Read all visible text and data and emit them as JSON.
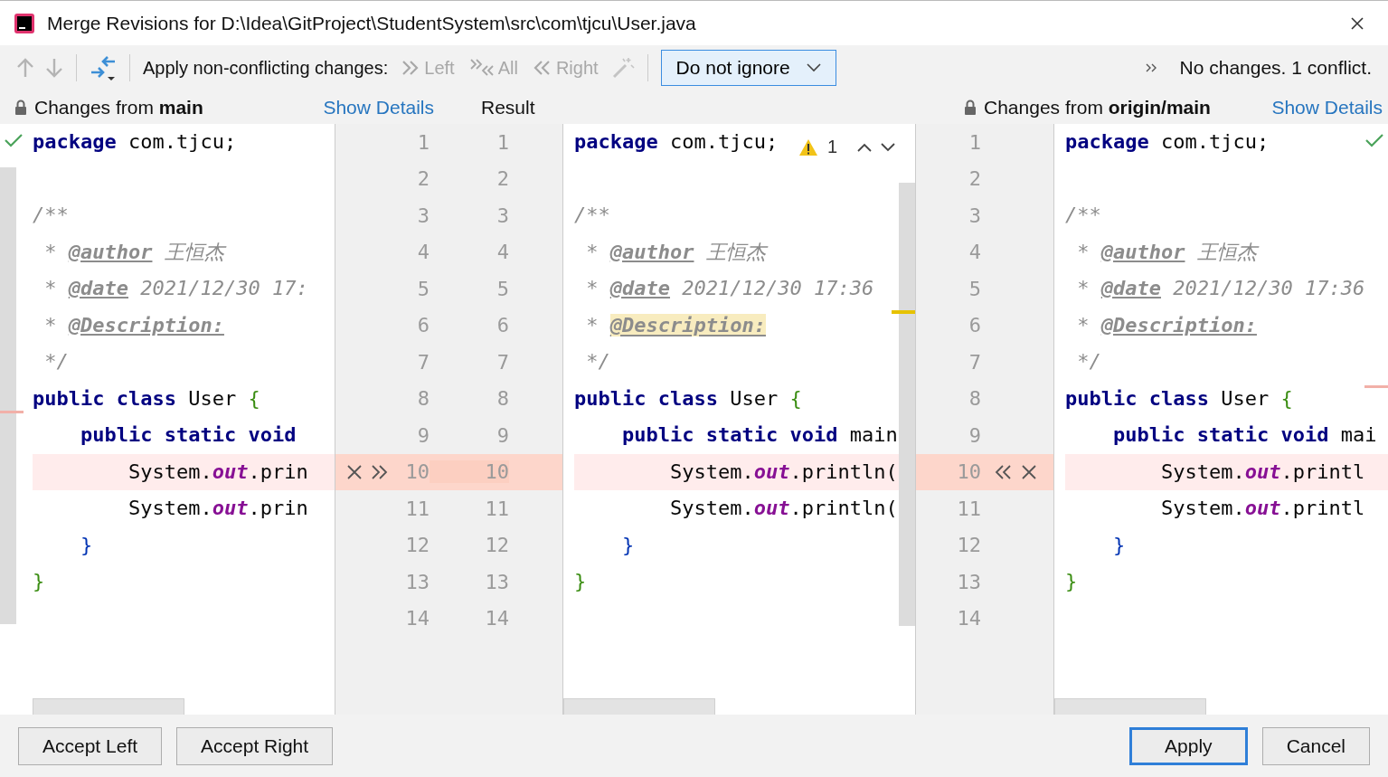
{
  "window": {
    "title": "Merge Revisions for D:\\Idea\\GitProject\\StudentSystem\\src\\com\\tjcu\\User.java"
  },
  "toolbar": {
    "apply_label": "Apply non-conflicting changes:",
    "actions": [
      {
        "kind": "left",
        "label": "Left",
        "disabled": true
      },
      {
        "kind": "all",
        "label": "All",
        "disabled": true
      },
      {
        "kind": "right",
        "label": "Right",
        "disabled": true
      }
    ],
    "ignore": {
      "value": "Do not ignore"
    },
    "status": "No changes. 1 conflict."
  },
  "left": {
    "prefix": "Changes from ",
    "branch": "main",
    "details": "Show Details",
    "lines": [
      {
        "conflict": false,
        "tokens": [
          {
            "text": "package",
            "kind": "kw"
          },
          {
            "text": " com.tjcu;",
            "kind": "p"
          }
        ]
      },
      {
        "conflict": false
      },
      {
        "conflict": false,
        "tokens": [
          {
            "text": "/**",
            "kind": "c"
          }
        ]
      },
      {
        "conflict": false,
        "tokens": [
          {
            "text": " * ",
            "kind": "c"
          },
          {
            "text": "@author",
            "kind": "tag"
          },
          {
            "text": " 王恒杰",
            "kind": "c"
          }
        ]
      },
      {
        "conflict": false,
        "tokens": [
          {
            "text": " * ",
            "kind": "c"
          },
          {
            "text": "@date",
            "kind": "tag"
          },
          {
            "text": " 2021/12/30 17:",
            "kind": "c"
          }
        ]
      },
      {
        "conflict": false,
        "tokens": [
          {
            "text": " * ",
            "kind": "c"
          },
          {
            "text": "@Description:",
            "kind": "tag"
          }
        ]
      },
      {
        "conflict": false,
        "tokens": [
          {
            "text": " */",
            "kind": "c"
          }
        ]
      },
      {
        "conflict": false,
        "tokens": [
          {
            "text": "public class",
            "kind": "kw"
          },
          {
            "text": " User ",
            "kind": "p"
          },
          {
            "text": "{",
            "kind": "b1"
          }
        ]
      },
      {
        "conflict": false,
        "tokens": [
          {
            "text": "    public static void",
            "kind": "kw"
          }
        ]
      },
      {
        "conflict": true,
        "tokens": [
          {
            "text": "        System.",
            "kind": "p"
          },
          {
            "text": "out",
            "kind": "f"
          },
          {
            "text": ".prin",
            "kind": "p"
          }
        ]
      },
      {
        "conflict": false,
        "tokens": [
          {
            "text": "        System.",
            "kind": "p"
          },
          {
            "text": "out",
            "kind": "f"
          },
          {
            "text": ".prin",
            "kind": "p"
          }
        ]
      },
      {
        "conflict": false,
        "tokens": [
          {
            "text": "    }",
            "kind": "b2"
          }
        ]
      },
      {
        "conflict": false,
        "tokens": [
          {
            "text": "}",
            "kind": "b1"
          }
        ]
      },
      {
        "conflict": false
      }
    ]
  },
  "left_gutter": [
    {
      "base": "1",
      "result": "1",
      "conflict": false
    },
    {
      "base": "2",
      "result": "2",
      "conflict": false
    },
    {
      "base": "3",
      "result": "3",
      "conflict": false
    },
    {
      "base": "4",
      "result": "4",
      "conflict": false
    },
    {
      "base": "5",
      "result": "5",
      "conflict": false
    },
    {
      "base": "6",
      "result": "6",
      "conflict": false
    },
    {
      "base": "7",
      "result": "7",
      "conflict": false
    },
    {
      "base": "8",
      "result": "8",
      "conflict": false
    },
    {
      "base": "9",
      "result": "9",
      "conflict": false
    },
    {
      "base": "10",
      "result": "10",
      "conflict": true
    },
    {
      "base": "11",
      "result": "11",
      "conflict": false
    },
    {
      "base": "12",
      "result": "12",
      "conflict": false
    },
    {
      "base": "13",
      "result": "13",
      "conflict": false
    },
    {
      "base": "14",
      "result": "14",
      "conflict": false
    }
  ],
  "result": {
    "title": "Result",
    "warnings": "1",
    "lines": [
      {
        "conflict": false,
        "tokens": [
          {
            "text": "package",
            "kind": "kw"
          },
          {
            "text": " com.tjcu;",
            "kind": "p"
          }
        ]
      },
      {
        "conflict": false
      },
      {
        "conflict": false,
        "tokens": [
          {
            "text": "/**",
            "kind": "c"
          }
        ]
      },
      {
        "conflict": false,
        "tokens": [
          {
            "text": " * ",
            "kind": "c"
          },
          {
            "text": "@author",
            "kind": "tag"
          },
          {
            "text": " 王恒杰",
            "kind": "c"
          }
        ]
      },
      {
        "conflict": false,
        "tokens": [
          {
            "text": " * ",
            "kind": "c"
          },
          {
            "text": "@date",
            "kind": "tag"
          },
          {
            "text": " 2021/12/30 17:36",
            "kind": "c"
          }
        ]
      },
      {
        "conflict": false,
        "tokens": [
          {
            "text": " * ",
            "kind": "c"
          },
          {
            "text": "@Description:",
            "kind": "taghl"
          }
        ]
      },
      {
        "conflict": false,
        "tokens": [
          {
            "text": " */",
            "kind": "c"
          }
        ]
      },
      {
        "conflict": false,
        "tokens": [
          {
            "text": "public class",
            "kind": "kw"
          },
          {
            "text": " User ",
            "kind": "p"
          },
          {
            "text": "{",
            "kind": "b1"
          }
        ]
      },
      {
        "conflict": false,
        "tokens": [
          {
            "text": "    public static void",
            "kind": "kw"
          },
          {
            "text": " main",
            "kind": "p"
          }
        ]
      },
      {
        "conflict": true,
        "tokens": [
          {
            "text": "        System.",
            "kind": "p"
          },
          {
            "text": "out",
            "kind": "f"
          },
          {
            "text": ".println(",
            "kind": "p"
          }
        ]
      },
      {
        "conflict": false,
        "tokens": [
          {
            "text": "        System.",
            "kind": "p"
          },
          {
            "text": "out",
            "kind": "f"
          },
          {
            "text": ".println(",
            "kind": "p"
          }
        ]
      },
      {
        "conflict": false,
        "tokens": [
          {
            "text": "    }",
            "kind": "b2"
          }
        ]
      },
      {
        "conflict": false,
        "tokens": [
          {
            "text": "}",
            "kind": "b1"
          }
        ]
      },
      {
        "conflict": false
      }
    ]
  },
  "right_gutter": [
    {
      "number": "1",
      "conflict": false
    },
    {
      "number": "2",
      "conflict": false
    },
    {
      "number": "3",
      "conflict": false
    },
    {
      "number": "4",
      "conflict": false
    },
    {
      "number": "5",
      "conflict": false
    },
    {
      "number": "6",
      "conflict": false
    },
    {
      "number": "7",
      "conflict": false
    },
    {
      "number": "8",
      "conflict": false
    },
    {
      "number": "9",
      "conflict": false
    },
    {
      "number": "10",
      "conflict": true
    },
    {
      "number": "11",
      "conflict": false
    },
    {
      "number": "12",
      "conflict": false
    },
    {
      "number": "13",
      "conflict": false
    },
    {
      "number": "14",
      "conflict": false
    }
  ],
  "right": {
    "prefix": "Changes from ",
    "branch": "origin/main",
    "details": "Show Details",
    "lines": [
      {
        "conflict": false,
        "tokens": [
          {
            "text": "package",
            "kind": "kw"
          },
          {
            "text": " com.tjcu;",
            "kind": "p"
          }
        ]
      },
      {
        "conflict": false
      },
      {
        "conflict": false,
        "tokens": [
          {
            "text": "/**",
            "kind": "c"
          }
        ]
      },
      {
        "conflict": false,
        "tokens": [
          {
            "text": " * ",
            "kind": "c"
          },
          {
            "text": "@author",
            "kind": "tag"
          },
          {
            "text": " 王恒杰",
            "kind": "c"
          }
        ]
      },
      {
        "conflict": false,
        "tokens": [
          {
            "text": " * ",
            "kind": "c"
          },
          {
            "text": "@date",
            "kind": "tag"
          },
          {
            "text": " 2021/12/30 17:36",
            "kind": "c"
          }
        ]
      },
      {
        "conflict": false,
        "tokens": [
          {
            "text": " * ",
            "kind": "c"
          },
          {
            "text": "@Description:",
            "kind": "tag"
          }
        ]
      },
      {
        "conflict": false,
        "tokens": [
          {
            "text": " */",
            "kind": "c"
          }
        ]
      },
      {
        "conflict": false,
        "tokens": [
          {
            "text": "public class",
            "kind": "kw"
          },
          {
            "text": " User ",
            "kind": "p"
          },
          {
            "text": "{",
            "kind": "b1"
          }
        ]
      },
      {
        "conflict": false,
        "tokens": [
          {
            "text": "    public static void",
            "kind": "kw"
          },
          {
            "text": " mai",
            "kind": "p"
          }
        ]
      },
      {
        "conflict": true,
        "tokens": [
          {
            "text": "        System.",
            "kind": "p"
          },
          {
            "text": "out",
            "kind": "f"
          },
          {
            "text": ".printl",
            "kind": "p"
          }
        ]
      },
      {
        "conflict": false,
        "tokens": [
          {
            "text": "        System.",
            "kind": "p"
          },
          {
            "text": "out",
            "kind": "f"
          },
          {
            "text": ".printl",
            "kind": "p"
          }
        ]
      },
      {
        "conflict": false,
        "tokens": [
          {
            "text": "    }",
            "kind": "b2"
          }
        ]
      },
      {
        "conflict": false,
        "tokens": [
          {
            "text": "}",
            "kind": "b1"
          }
        ]
      },
      {
        "conflict": false
      }
    ]
  },
  "buttons": [
    {
      "label": "Accept Left",
      "default": false
    },
    {
      "label": "Accept Right",
      "default": false
    },
    {
      "label": "Apply",
      "default": true
    },
    {
      "label": "Cancel",
      "default": false
    }
  ]
}
